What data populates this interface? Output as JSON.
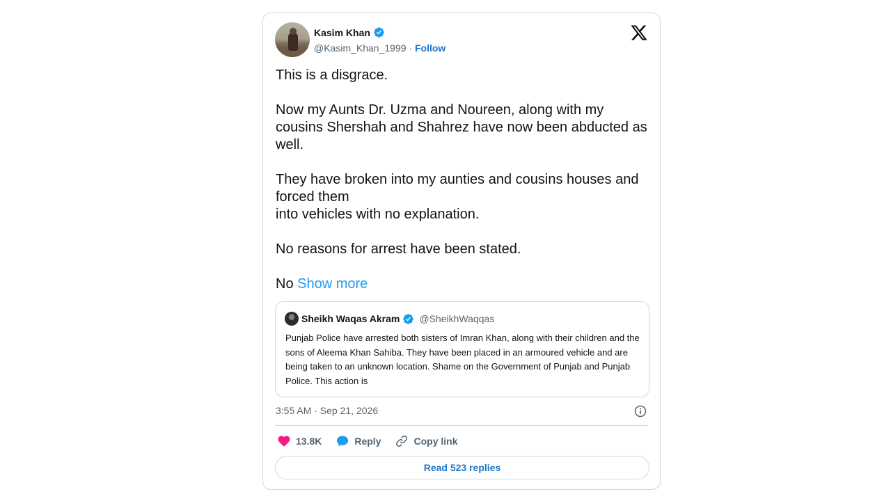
{
  "tweet": {
    "author": {
      "name": "Kasim Khan",
      "handle": "@Kasim_Khan_1999",
      "separator": "·",
      "follow_label": "Follow",
      "verified": true
    },
    "body": {
      "p1": "This is a disgrace.",
      "p2": "Now my Aunts Dr. Uzma and Noureen, along with my cousins Shershah and Shahrez have now been abducted as well.",
      "p3_line1": "They have broken into my aunties and cousins houses and forced them",
      "p3_line2": "into vehicles with no explanation.",
      "p4": "No reasons for arrest have been stated.",
      "p5_start": "No",
      "show_more": "Show more"
    },
    "quoted": {
      "name": "Sheikh Waqas Akram",
      "handle": "@SheikhWaqqas",
      "verified": true,
      "text": "Punjab Police have arrested both sisters of Imran Khan, along with their children and the sons of Aleema Khan Sahiba. They have been placed in an armoured vehicle and are being taken to an unknown location. Shame on the Government of Punjab and Punjab Police. This action is"
    },
    "timestamp": "3:55 AM · Sep 21, 2026",
    "actions": {
      "likes": "13.8K",
      "reply_label": "Reply",
      "copy_link_label": "Copy link"
    },
    "read_replies_label": "Read 523 replies"
  },
  "icons": {
    "platform_logo": "x-logo-icon",
    "verified": "verified-badge-icon",
    "info": "info-icon",
    "like": "heart-icon",
    "reply": "reply-bubble-icon",
    "copy_link": "link-icon"
  },
  "colors": {
    "accent": "#1d9bf0",
    "link": "#1d74c9",
    "like": "#f91880",
    "border": "#cfd9de",
    "secondary_text": "#536471"
  }
}
